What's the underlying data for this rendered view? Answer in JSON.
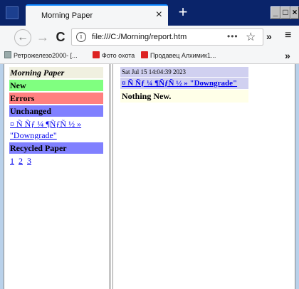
{
  "browser": {
    "tab_title": "Morning Paper",
    "tab_close": "×",
    "new_tab": "+",
    "window_buttons": {
      "minimize": "_",
      "maximize": "□",
      "close": "×"
    },
    "url": "file:///C:/Morning/report.htm",
    "url_more": "•••",
    "bookmark_star": "☆",
    "toolbar_overflow": "»",
    "menu": "≡",
    "nav": {
      "back": "←",
      "forward": "→",
      "reload": "C"
    },
    "bookmarks": [
      {
        "label": "Ретрожелезо2000- [..."
      },
      {
        "label": "Фото охота"
      },
      {
        "label": "Продавец Алхимик1..."
      }
    ],
    "bookmarks_overflow": "»"
  },
  "left_frame": {
    "title": "Morning Paper",
    "new": "New",
    "errors": "Errors",
    "unchanged": "Unchanged",
    "unchanged_link": "¤ Ñ Ñƒ ¼ ¶ÑƒÑ ½ » \"Downgrade\"",
    "recycled": "Recycled Paper",
    "pages": [
      "1",
      "2",
      "3"
    ]
  },
  "right_frame": {
    "date": "Sat Jul 15 14:04:39 2023",
    "link": "¤ Ñ Ñƒ ¼ ¶ÑƒÑ ½ » \"Downgrade\"",
    "status": "Nothing New."
  },
  "colors": {
    "new_bg": "#80ff80",
    "errors_bg": "#ff8080",
    "unchanged_bg": "#8080ff",
    "title_bg": "#f0f0e0",
    "date_bg": "#d0d0f0",
    "status_bg": "#ffffe8",
    "link": "#0000ee"
  }
}
